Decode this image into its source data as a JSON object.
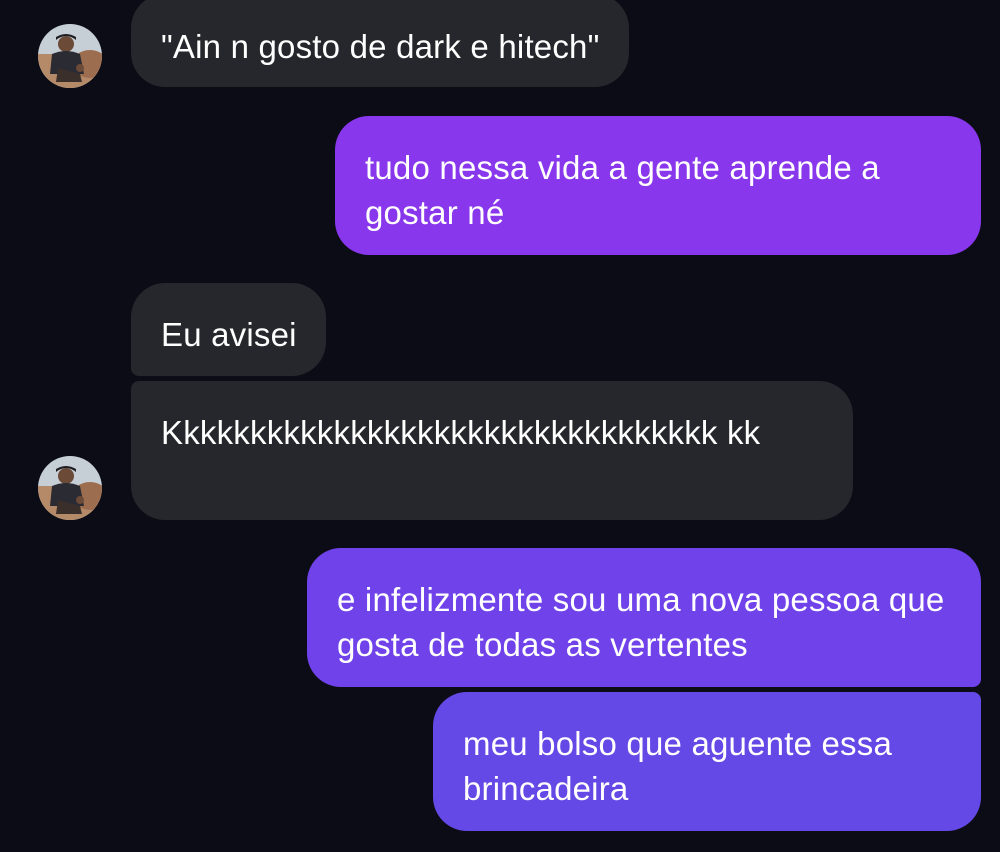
{
  "messages": [
    {
      "id": "m1",
      "direction": "incoming",
      "text": "\"Ain n gosto de dark e hitech\""
    },
    {
      "id": "m2",
      "direction": "outgoing",
      "text": "tudo nessa vida a gente aprende a gostar né"
    },
    {
      "id": "m3",
      "direction": "incoming",
      "text": "Eu avisei"
    },
    {
      "id": "m4",
      "direction": "incoming",
      "text": "Kkkkkkkkkkkkkkkkkkkkkkkkkkkkkkkkk kk"
    },
    {
      "id": "m5",
      "direction": "outgoing",
      "text": "e infelizmente sou uma nova pessoa que gosta de todas as vertentes"
    },
    {
      "id": "m6",
      "direction": "outgoing",
      "text": "meu bolso que aguente essa brincadeira"
    }
  ],
  "colors": {
    "background": "#0b0c15",
    "incoming_bubble": "#26272c",
    "outgoing_gradient_top": "#8837ec",
    "outgoing_gradient_bottom": "#6449e6",
    "text": "#ffffff"
  },
  "icons": {
    "avatar": "contact-avatar-photo"
  }
}
